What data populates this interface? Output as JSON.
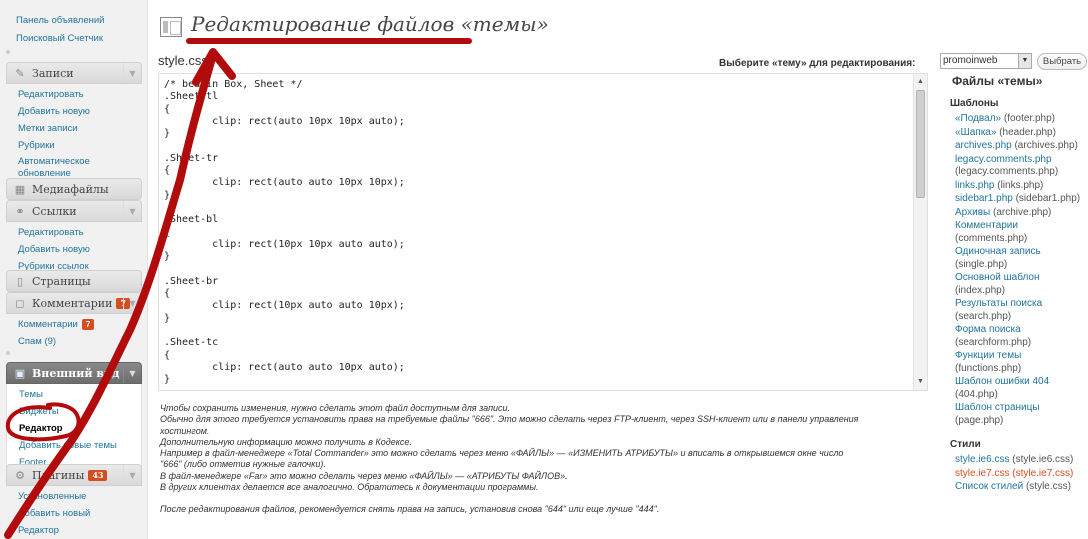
{
  "sidebar": {
    "top_links": [
      "Панель объявлений",
      "Поисковый Счетчик"
    ],
    "posts": {
      "title": "Записи",
      "items": [
        "Редактировать",
        "Добавить новую",
        "Метки записи",
        "Рубрики",
        "Автоматическое",
        "обновление"
      ]
    },
    "media": {
      "title": "Медиафайлы"
    },
    "links": {
      "title": "Ссылки",
      "items": [
        "Редактировать",
        "Добавить новую",
        "Рубрики ссылок"
      ]
    },
    "pages": {
      "title": "Страницы"
    },
    "comments": {
      "title": "Комментарии",
      "badge": "7",
      "items": [
        "Комментарии",
        "Спам (9)"
      ],
      "items_badge": "7"
    },
    "appearance": {
      "title": "Внешний вид",
      "items": [
        "Темы",
        "Виджеты",
        "Редактор",
        "Добавить новые темы",
        "Footer"
      ]
    },
    "plugins": {
      "title": "Плагины",
      "badge": "43",
      "items": [
        "Установленные",
        "Добавить новый",
        "Редактор"
      ]
    }
  },
  "header": {
    "title": "Редактирование файлов «темы»",
    "file_name": "style.css",
    "select_label": "Выберите «тему» для редактирования:",
    "select_value": "promoinweb",
    "select_button": "Выбрать"
  },
  "editor": {
    "lines": [
      "/* beatin Box, Sheet */",
      ".Sheet-tl",
      "{",
      "        clip: rect(auto 10px 10px auto);",
      "}",
      "",
      ".Sheet-tr",
      "{",
      "        clip: rect(auto auto 10px 10px);",
      "}",
      "",
      ".Sheet-bl",
      "{",
      "        clip: rect(10px 10px auto auto);",
      "}",
      "",
      ".Sheet-br",
      "{",
      "        clip: rect(10px auto auto 10px);",
      "}",
      "",
      ".Sheet-tc",
      "{",
      "        clip: rect(auto auto 10px auto);",
      "}"
    ]
  },
  "notes": {
    "lines": [
      "Чтобы сохранить изменения, нужно сделать этот файл доступным для записи.",
      "Обычно для этого требуется установить права на требуемые файлы \"666\". Это можно сделать через FTP-клиент, через SSH-клиент или в панели управления",
      "хостингом.",
      "Дополнительную информацию можно получить в Кодексе.",
      "Например в файл-менеджере «Total Commander» это можно сделать через меню «ФАЙЛЫ» — «ИЗМЕНИТЬ АТРИБУТЫ» и вписать в открывшемся окне число",
      "\"666\" (либо отметив нужные галочки).",
      "В файл-менеджере «Far» это можно сделать через меню «ФАЙЛЫ» — «АТРИБУТЫ ФАЙЛОВ».",
      "В других клиентах делается все аналогично. Обратитесь к документации программы."
    ],
    "after": "После редактирования файлов, рекомендуется снять права на запись, установив снова \"644\" или еще лучше \"444\"."
  },
  "files_panel": {
    "title": "Файлы «темы»",
    "templates_title": "Шаблоны",
    "templates": [
      {
        "label": "«Подвал»",
        "file": "(footer.php)"
      },
      {
        "label": "«Шапка»",
        "file": "(header.php)"
      },
      {
        "label": "archives.php",
        "file": "(archives.php)"
      },
      {
        "label": "legacy.comments.php",
        "file": "(legacy.comments.php)"
      },
      {
        "label": "links.php",
        "file": "(links.php)"
      },
      {
        "label": "sidebar1.php",
        "file": "(sidebar1.php)"
      },
      {
        "label": "Архивы",
        "file": "(archive.php)"
      },
      {
        "label": "Комментарии",
        "file": "(comments.php)"
      },
      {
        "label": "Одиночная запись",
        "file": "(single.php)"
      },
      {
        "label": "Основной шаблон",
        "file": "(index.php)"
      },
      {
        "label": "Результаты поиска",
        "file": "(search.php)"
      },
      {
        "label": "Форма поиска",
        "file": "(searchform.php)"
      },
      {
        "label": "Функции темы",
        "file": "(functions.php)"
      },
      {
        "label": "Шаблон ошибки 404",
        "file": "(404.php)"
      },
      {
        "label": "Шаблон страницы",
        "file": "(page.php)"
      }
    ],
    "styles_title": "Стили",
    "styles": [
      {
        "label": "style.ie6.css",
        "file": "(style.ie6.css)"
      },
      {
        "label": "style.ie7.css",
        "file": "(style.ie7.css)"
      },
      {
        "label": "Список стилей",
        "file": "(style.css)"
      }
    ]
  },
  "colors": {
    "link": "#21759b",
    "active_file": "#d54e21",
    "annotation": "#b20b0b"
  }
}
